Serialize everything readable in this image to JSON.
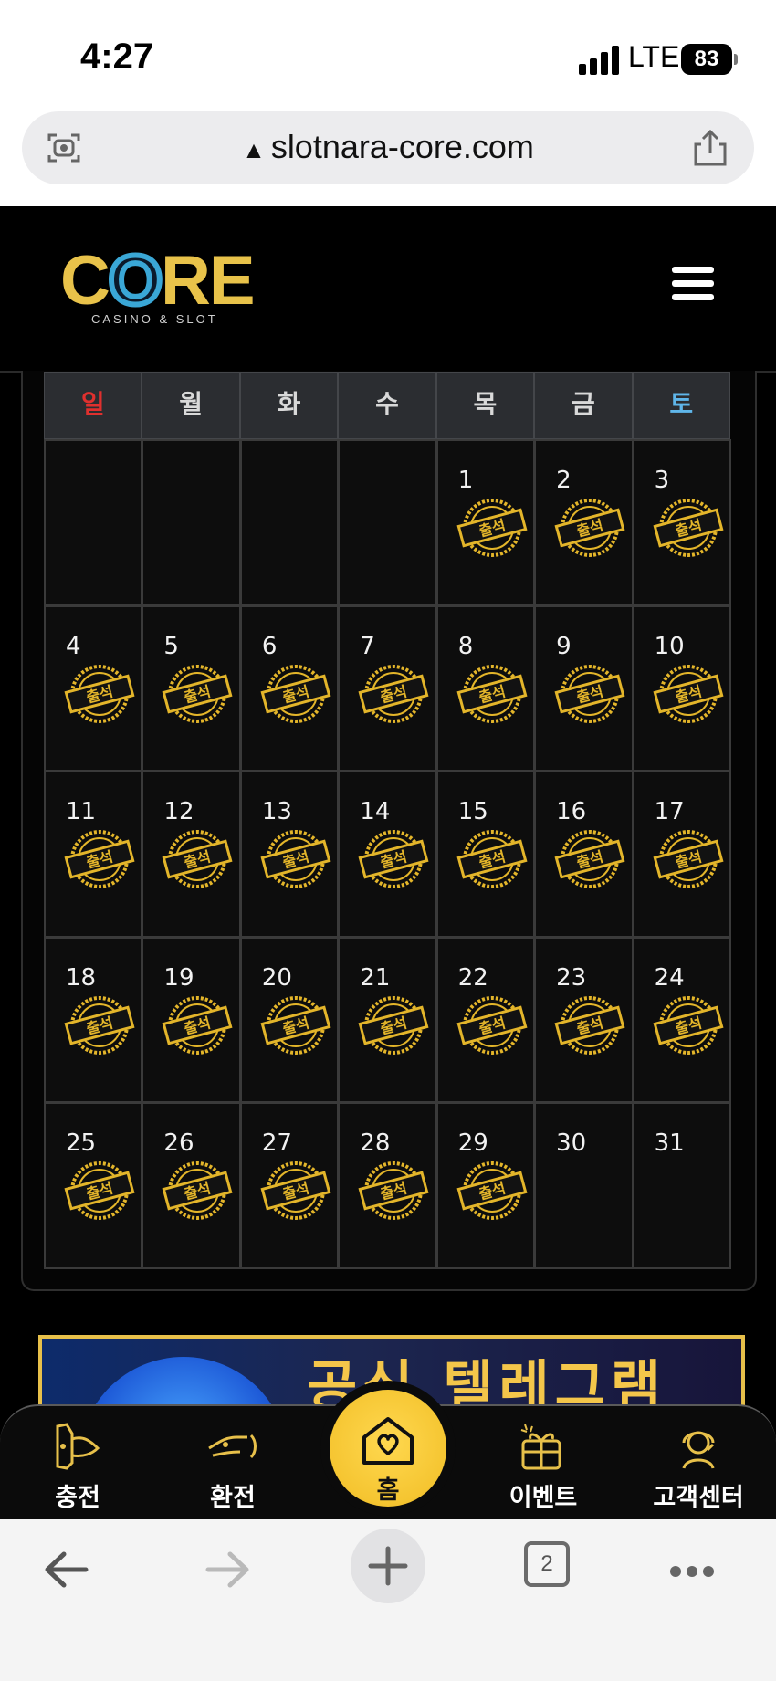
{
  "status_bar": {
    "time": "4:27",
    "network": "LTE",
    "battery": "83"
  },
  "browser": {
    "url": "slotnara-core.com",
    "open_tabs": "2"
  },
  "site": {
    "logo_text": "CORE",
    "logo_subtitle": "CASINO & SLOT"
  },
  "calendar": {
    "weekdays": [
      "일",
      "월",
      "화",
      "수",
      "목",
      "금",
      "토"
    ],
    "stamp_label": "출석",
    "leading_blank_cells": 4,
    "days_in_month": 31,
    "attended_through_day": 29
  },
  "banner": {
    "text": "공식 텔레그램"
  },
  "bottom_nav": {
    "charge": "충전",
    "exchange": "환전",
    "home": "홈",
    "event": "이벤트",
    "support": "고객센터"
  },
  "colors": {
    "accent_gold": "#f5c531",
    "sunday": "#e0302e",
    "saturday": "#5fb6ea"
  }
}
